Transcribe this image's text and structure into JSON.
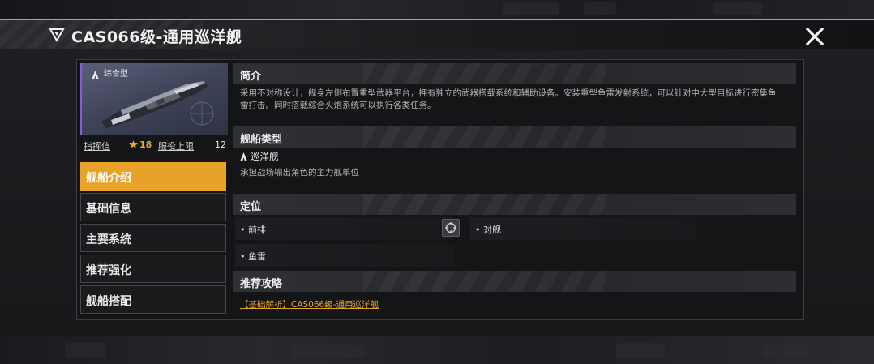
{
  "header": {
    "title": "CAS066级-通用巡洋舰",
    "close_icon": "close-icon"
  },
  "ship_card": {
    "type_label": "综合型",
    "type_icon": "cruiser-icon",
    "rarity_color": "#8a5bd6",
    "command_label": "指挥值",
    "command_value": "18",
    "service_label": "服役上限",
    "service_value": "12"
  },
  "nav": {
    "items": [
      {
        "label": "舰船介绍",
        "active": true
      },
      {
        "label": "基础信息",
        "active": false
      },
      {
        "label": "主要系统",
        "active": false
      },
      {
        "label": "推荐强化",
        "active": false
      },
      {
        "label": "舰船搭配",
        "active": false
      }
    ]
  },
  "sections": {
    "intro": {
      "title": "简介",
      "text": "采用不对称设计，舰身左侧布置重型武器平台，拥有独立的武器搭载系统和辅助设备。安装重型鱼雷发射系统，可以针对中大型目标进行密集鱼雷打击。同时搭载综合火炮系统可以执行各类任务。"
    },
    "ship_type": {
      "title": "舰船类型",
      "class_name": "巡洋舰",
      "description": "承担战场输出角色的主力舰单位"
    },
    "positioning": {
      "title": "定位",
      "tags": [
        "• 前排",
        "• 对舰",
        "• 鱼雷"
      ]
    },
    "guide": {
      "title": "推荐攻略",
      "link_text": "【基础解析】CAS066级-通用巡洋舰"
    }
  },
  "colors": {
    "accent": "#e8a22a",
    "panel": "#141517"
  }
}
